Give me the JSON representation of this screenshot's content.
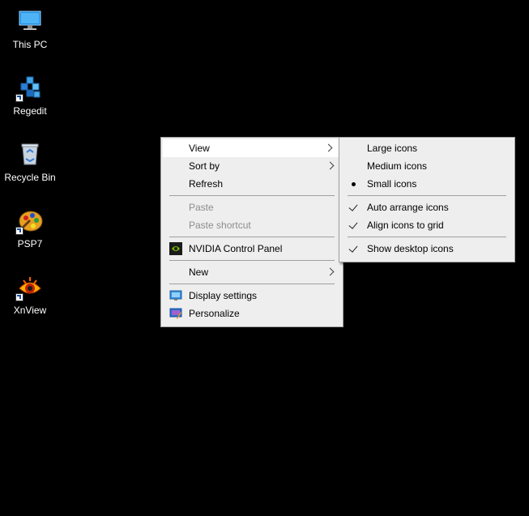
{
  "desktop": {
    "icons": [
      {
        "label": "This PC",
        "icon": "this-pc-icon"
      },
      {
        "label": "Regedit",
        "icon": "regedit-icon"
      },
      {
        "label": "Recycle Bin",
        "icon": "recycle-bin-icon"
      },
      {
        "label": "PSP7",
        "icon": "psp7-icon"
      },
      {
        "label": "XnView",
        "icon": "xnview-icon"
      }
    ]
  },
  "context_menu": {
    "items": {
      "view": "View",
      "sort_by": "Sort by",
      "refresh": "Refresh",
      "paste": "Paste",
      "paste_shortcut": "Paste shortcut",
      "nvidia": "NVIDIA Control Panel",
      "new": "New",
      "display_settings": "Display settings",
      "personalize": "Personalize"
    }
  },
  "view_submenu": {
    "items": {
      "large_icons": "Large icons",
      "medium_icons": "Medium icons",
      "small_icons": "Small icons",
      "auto_arrange": "Auto arrange icons",
      "align_grid": "Align icons to grid",
      "show_desktop_icons": "Show desktop icons"
    },
    "selected_size": "Small icons",
    "checked": [
      "Auto arrange icons",
      "Align icons to grid",
      "Show desktop icons"
    ]
  },
  "colors": {
    "desktop_background": "#000000",
    "menu_background": "#eeeeee",
    "menu_border": "#a0a0a0",
    "disabled_text": "#8d8d8d"
  }
}
